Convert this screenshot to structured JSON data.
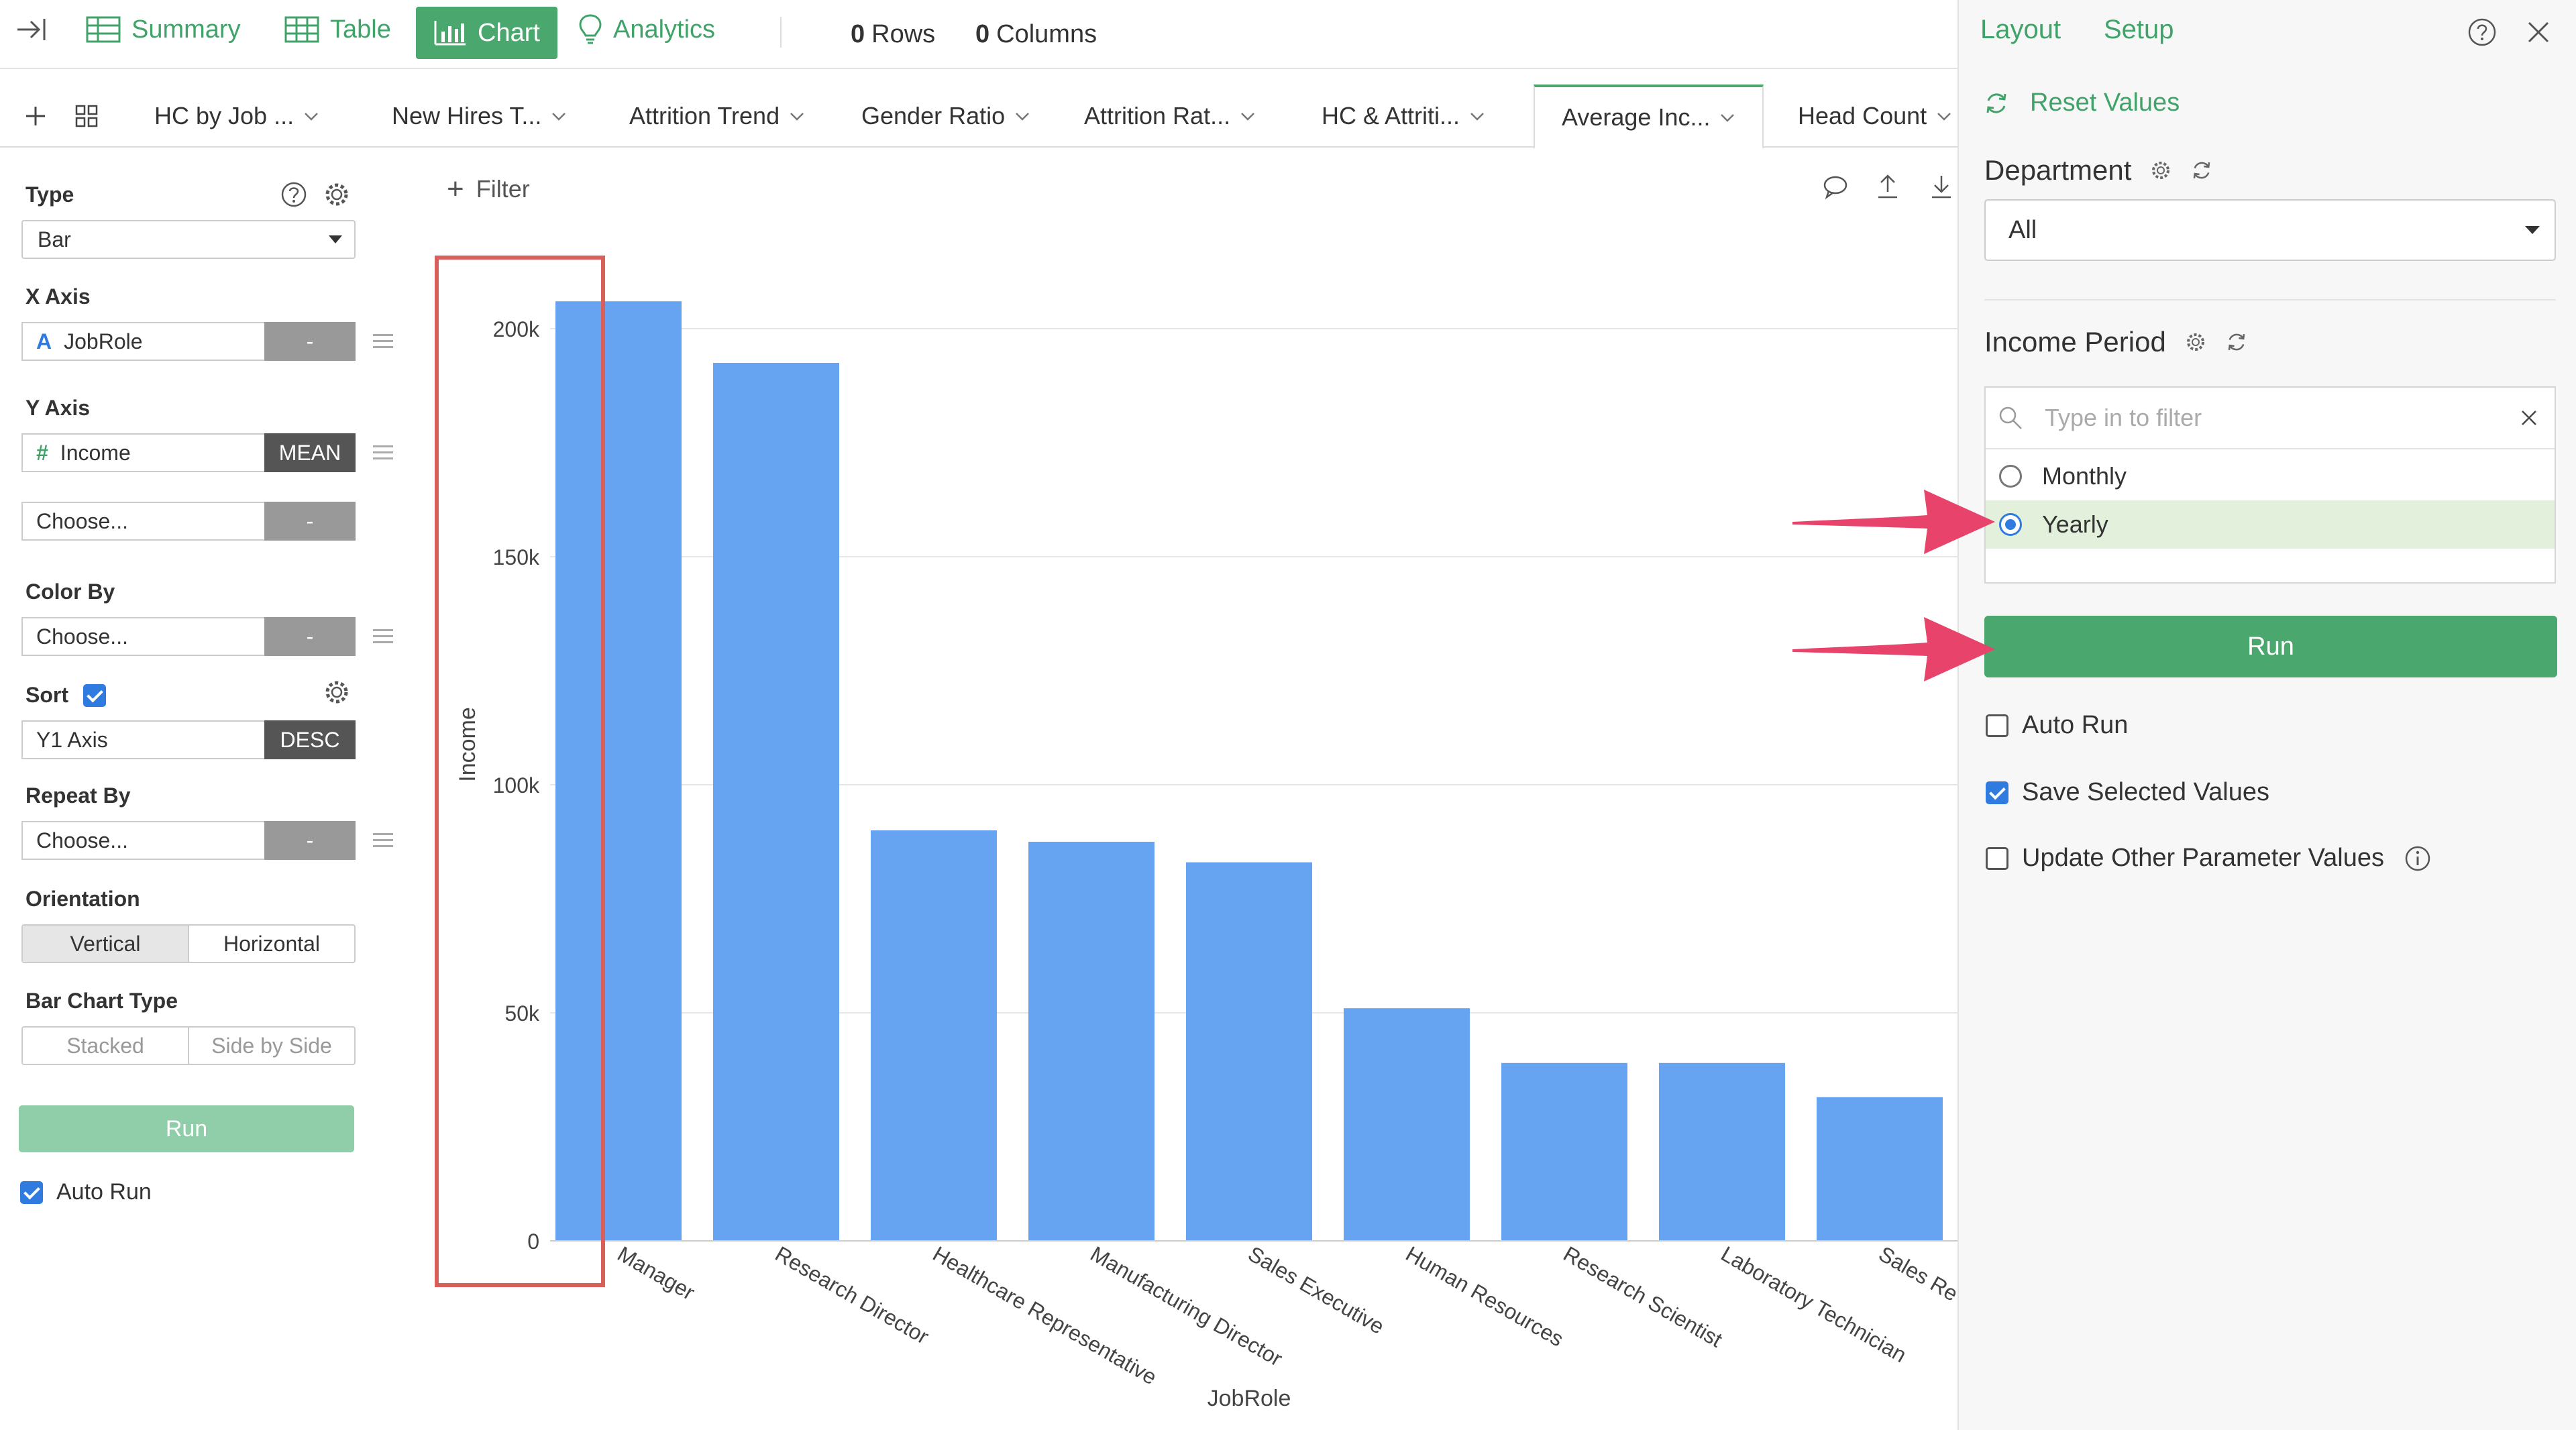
{
  "nav": {
    "summary": "Summary",
    "table": "Table",
    "chart": "Chart",
    "analytics": "Analytics",
    "rows_count": "0",
    "rows_label": "Rows",
    "cols_count": "0",
    "cols_label": "Columns"
  },
  "tabs": [
    {
      "label": "HC by Job ..."
    },
    {
      "label": "New Hires T..."
    },
    {
      "label": "Attrition Trend"
    },
    {
      "label": "Gender Ratio"
    },
    {
      "label": "Attrition Rat..."
    },
    {
      "label": "HC & Attriti..."
    },
    {
      "label": "Average Inc...",
      "active": true
    },
    {
      "label": "Head Count"
    }
  ],
  "left": {
    "type_label": "Type",
    "type_value": "Bar",
    "x_label": "X Axis",
    "x_tag": "A",
    "x_field": "JobRole",
    "x_agg": "-",
    "y_label": "Y Axis",
    "y_tag": "#",
    "y_field": "Income",
    "y_agg": "MEAN",
    "y2_field": "Choose...",
    "y2_agg": "-",
    "color_label": "Color By",
    "color_field": "Choose...",
    "color_agg": "-",
    "sort_label": "Sort",
    "sort_field": "Y1 Axis",
    "sort_order": "DESC",
    "repeat_label": "Repeat By",
    "repeat_field": "Choose...",
    "repeat_agg": "-",
    "orientation_label": "Orientation",
    "orientation_vertical": "Vertical",
    "orientation_horizontal": "Horizontal",
    "bartype_label": "Bar Chart Type",
    "bartype_stacked": "Stacked",
    "bartype_side": "Side by Side",
    "run": "Run",
    "auto_run": "Auto Run"
  },
  "filter_label": "Filter",
  "right": {
    "layout": "Layout",
    "setup": "Setup",
    "reset": "Reset Values",
    "department_label": "Department",
    "department_value": "All",
    "period_label": "Income Period",
    "filter_placeholder": "Type in to filter",
    "options": [
      "Monthly",
      "Yearly"
    ],
    "selected_option": "Yearly",
    "run": "Run",
    "auto_run": "Auto Run",
    "save_selected": "Save Selected Values",
    "update_other": "Update Other Parameter Values"
  },
  "colors": {
    "accent_green": "#4aa76e",
    "bar_blue": "#66a3f0",
    "highlight_red": "#d95f5a",
    "arrow_pink": "#e8436a",
    "checkbox_blue": "#2f7be0"
  },
  "chart_data": {
    "type": "bar",
    "categories": [
      "Manager",
      "Research Director",
      "Healthcare Representative",
      "Manufacturing Director",
      "Sales Executive",
      "Human Resources",
      "Research Scientist",
      "Laboratory Technician",
      "Sales Re"
    ],
    "values": [
      206000,
      192500,
      90000,
      87500,
      83000,
      51000,
      39000,
      39000,
      31500
    ],
    "xlabel": "JobRole",
    "ylabel": "Income",
    "ylim": [
      0,
      215000
    ],
    "yticks": [
      0,
      50000,
      100000,
      150000,
      200000
    ],
    "ytick_labels": [
      "0",
      "50k",
      "100k",
      "150k",
      "200k"
    ],
    "grid": true
  }
}
